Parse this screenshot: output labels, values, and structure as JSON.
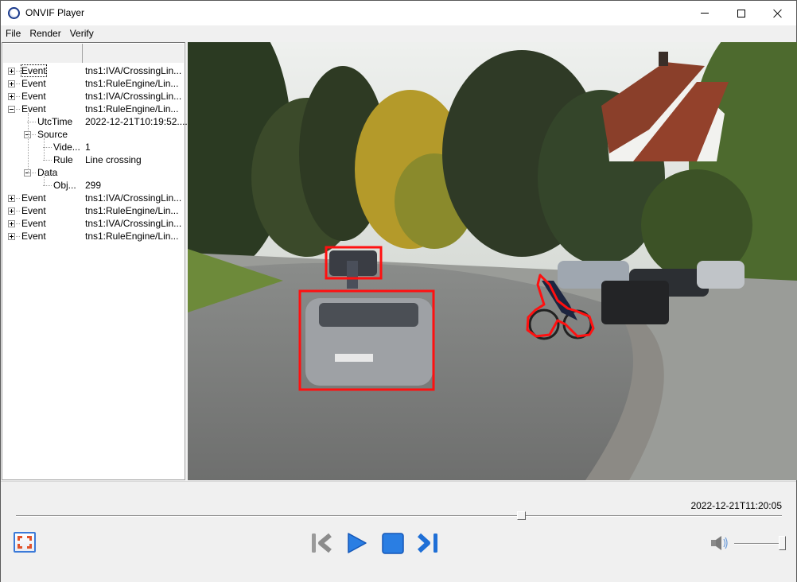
{
  "window": {
    "title": "ONVIF Player",
    "app_icon": "onvif-ring-icon",
    "controls": {
      "minimize": "minimize-icon",
      "maximize": "maximize-icon",
      "close": "close-icon"
    }
  },
  "menu": {
    "items": [
      "File",
      "Render",
      "Verify"
    ]
  },
  "event_tree": {
    "columns": [
      "",
      ""
    ],
    "rows": [
      {
        "name": "Event",
        "value": "tns1:IVA/CrossingLin...",
        "level": 0,
        "expander": "plus",
        "focused": true
      },
      {
        "name": "Event",
        "value": "tns1:RuleEngine/Lin...",
        "level": 0,
        "expander": "plus"
      },
      {
        "name": "Event",
        "value": "tns1:IVA/CrossingLin...",
        "level": 0,
        "expander": "plus"
      },
      {
        "name": "Event",
        "value": "tns1:RuleEngine/Lin...",
        "level": 0,
        "expander": "minus"
      },
      {
        "name": "UtcTime",
        "value": "2022-12-21T10:19:52....",
        "level": 1,
        "expander": "none"
      },
      {
        "name": "Source",
        "value": "",
        "level": 1,
        "expander": "minus"
      },
      {
        "name": "Vide...",
        "value": "1",
        "level": 2,
        "expander": "none"
      },
      {
        "name": "Rule",
        "value": "Line crossing",
        "level": 2,
        "expander": "none"
      },
      {
        "name": "Data",
        "value": "",
        "level": 1,
        "expander": "minus"
      },
      {
        "name": "Obj...",
        "value": "299",
        "level": 2,
        "expander": "none"
      },
      {
        "name": "Event",
        "value": "tns1:IVA/CrossingLin...",
        "level": 0,
        "expander": "plus"
      },
      {
        "name": "Event",
        "value": "tns1:RuleEngine/Lin...",
        "level": 0,
        "expander": "plus"
      },
      {
        "name": "Event",
        "value": "tns1:IVA/CrossingLin...",
        "level": 0,
        "expander": "plus"
      },
      {
        "name": "Event",
        "value": "tns1:RuleEngine/Lin...",
        "level": 0,
        "expander": "plus"
      }
    ]
  },
  "video": {
    "scene": "street with cars, cyclists, trees and house",
    "overlay_color": "#ff1010",
    "detections": [
      {
        "label": "car (far)",
        "shape": "box"
      },
      {
        "label": "car (near)",
        "shape": "box"
      },
      {
        "label": "cyclist",
        "shape": "polygon"
      }
    ]
  },
  "playback": {
    "timestamp": "2022-12-21T11:20:05",
    "position_fraction": 0.659,
    "volume_fraction": 1.0,
    "buttons": {
      "fit": "fit-to-window-icon",
      "previous": "skip-previous-icon",
      "play": "play-icon",
      "stop": "stop-icon",
      "next": "skip-next-icon",
      "volume": "speaker-icon"
    },
    "previous_enabled": false
  }
}
